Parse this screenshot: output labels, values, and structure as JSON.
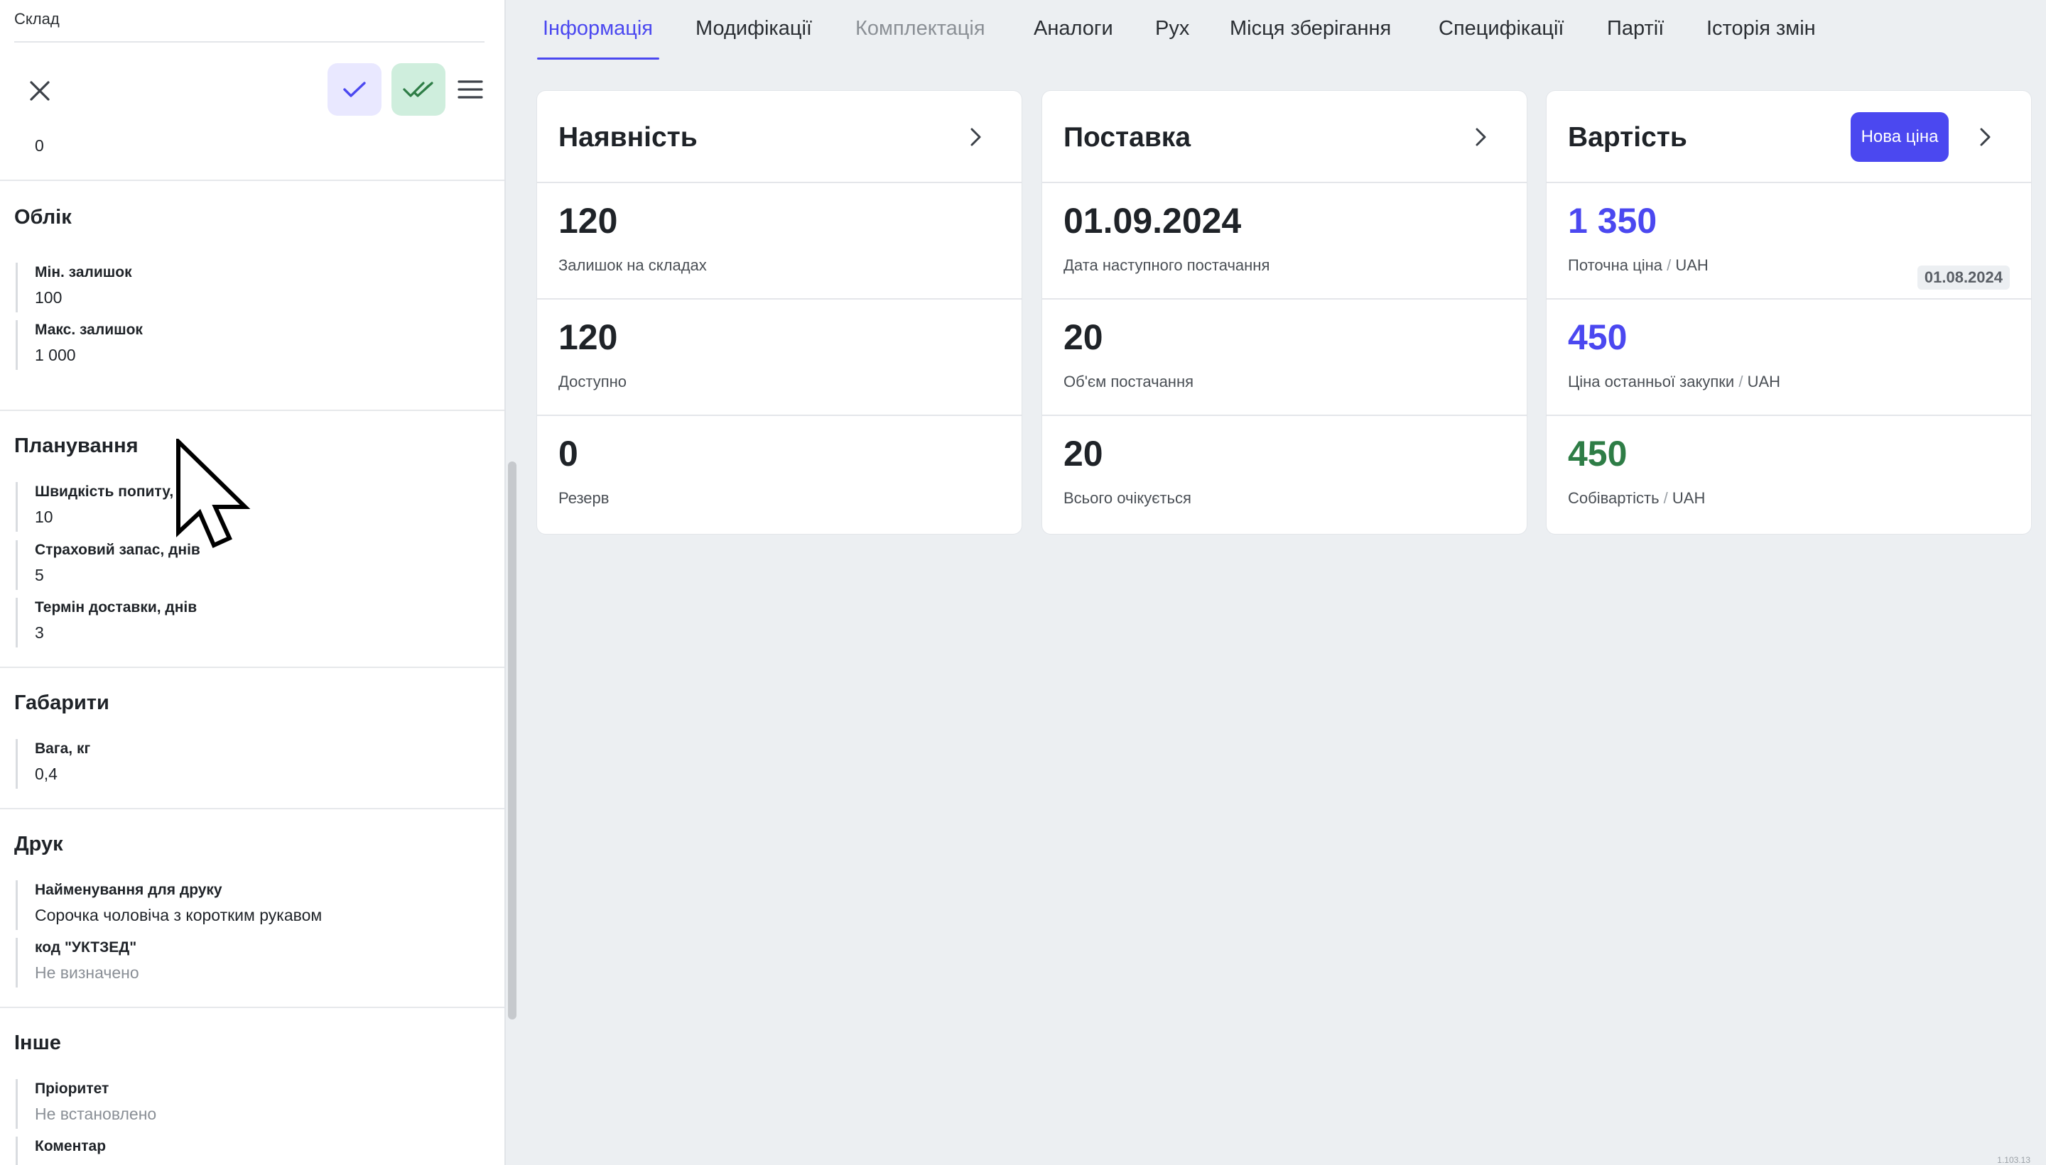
{
  "left_panel": {
    "breadcrumb": "Склад",
    "top_value": "0",
    "sections": {
      "oblik": {
        "title": "Облік",
        "fields": [
          {
            "label": "Мін. залишок",
            "value": "100"
          },
          {
            "label": "Макс. залишок",
            "value": "1 000"
          }
        ]
      },
      "planning": {
        "title": "Планування",
        "fields": [
          {
            "label": "Швидкість попиту,",
            "value": "10"
          },
          {
            "label": "Страховий запас, днів",
            "value": "5"
          },
          {
            "label": "Термін доставки, днів",
            "value": "3"
          }
        ]
      },
      "dimensions": {
        "title": "Габарити",
        "fields": [
          {
            "label": "Вага, кг",
            "value": "0,4"
          }
        ]
      },
      "print": {
        "title": "Друк",
        "fields": [
          {
            "label": "Найменування для друку",
            "value": "Сорочка чоловіча з коротким рукавом"
          },
          {
            "label": "код \"УКТЗЕД\"",
            "value": "Не визначено"
          }
        ]
      },
      "other": {
        "title": "Інше",
        "fields": [
          {
            "label": "Пріоритет",
            "value": "Не встановлено"
          },
          {
            "label": "Коментар",
            "value": ""
          }
        ]
      }
    }
  },
  "tabs": [
    {
      "label": "Інформація",
      "state": "active"
    },
    {
      "label": "Модифікації",
      "state": "normal"
    },
    {
      "label": "Комплектація",
      "state": "disabled"
    },
    {
      "label": "Аналоги",
      "state": "normal"
    },
    {
      "label": "Рух",
      "state": "normal"
    },
    {
      "label": "Місця зберігання",
      "state": "normal"
    },
    {
      "label": "Специфікації",
      "state": "normal"
    },
    {
      "label": "Партії",
      "state": "normal"
    },
    {
      "label": "Історія змін",
      "state": "normal"
    }
  ],
  "cards": {
    "availability": {
      "title": "Наявність",
      "metrics": [
        {
          "value": "120",
          "label": "Залишок на складах"
        },
        {
          "value": "120",
          "label": "Доступно"
        },
        {
          "value": "0",
          "label": "Резерв"
        }
      ]
    },
    "supply": {
      "title": "Поставка",
      "metrics": [
        {
          "value": "01.09.2024",
          "label": "Дата наступного постачання"
        },
        {
          "value": "20",
          "label": "Об'єм постачання"
        },
        {
          "value": "20",
          "label": "Всього очікується"
        }
      ]
    },
    "cost": {
      "title": "Вартість",
      "new_price_button": "Нова ціна",
      "separator": "/",
      "metrics": [
        {
          "value": "1 350",
          "label": "Поточна ціна",
          "unit": "UAH",
          "badge": "01.08.2024"
        },
        {
          "value": "450",
          "label": "Ціна останньої закупки",
          "unit": "UAH"
        },
        {
          "value": "450",
          "label": "Собівартість",
          "unit": "UAH"
        }
      ]
    }
  },
  "colors": {
    "accent": "#4b48f0",
    "positive": "#2e7d46",
    "confirm_bg": "#e9e8ff",
    "confirm_all_bg": "#cfeedd"
  },
  "icons": {
    "close": "close-icon",
    "confirm": "check-icon",
    "confirm_all": "double-check-icon",
    "menu": "hamburger-menu-icon",
    "card_open": "chevron-right-icon"
  },
  "version": "1.103.13"
}
